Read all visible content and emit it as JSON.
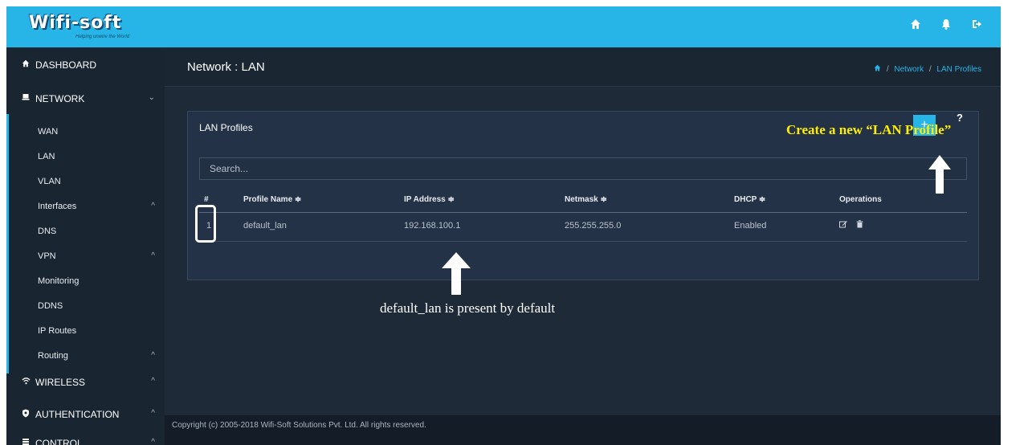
{
  "brand": {
    "logo_text": "Wifi-soft",
    "tagline": "Helping unwire the World"
  },
  "topbar": {
    "icons": [
      "home-icon",
      "bell-icon",
      "sign-out-icon"
    ]
  },
  "sidebar": {
    "sections": [
      {
        "label": "DASHBOARD",
        "icon": "home-icon"
      },
      {
        "label": "NETWORK",
        "icon": "monitor-icon",
        "caret": "⌄"
      },
      {
        "label": "WIRELESS",
        "icon": "wifi-icon",
        "caret": "^"
      },
      {
        "label": "AUTHENTICATION",
        "icon": "shield-icon",
        "caret": "^"
      },
      {
        "label": "CONTROL",
        "icon": "control-icon",
        "caret": "^"
      }
    ],
    "network_items": [
      {
        "label": "WAN"
      },
      {
        "label": "LAN"
      },
      {
        "label": "VLAN"
      },
      {
        "label": "Interfaces",
        "caret": "^"
      },
      {
        "label": "DNS"
      },
      {
        "label": "VPN",
        "caret": "^"
      },
      {
        "label": "Monitoring"
      },
      {
        "label": "DDNS"
      },
      {
        "label": "IP Routes"
      },
      {
        "label": "Routing",
        "caret": "^"
      }
    ]
  },
  "page": {
    "title": "Network : LAN",
    "breadcrumb": {
      "home_icon": "home-icon",
      "sep": "/",
      "items": [
        "Network",
        "LAN Profiles"
      ]
    }
  },
  "card": {
    "title": "LAN Profiles",
    "help": "?",
    "add_button": "+",
    "search_placeholder": "Search...",
    "columns": [
      "#",
      "Profile Name ≑",
      "IP Address ≑",
      "Netmask ≑",
      "DHCP ≑",
      "Operations"
    ],
    "rows": [
      {
        "index": "1",
        "name": "default_lan",
        "ip": "192.168.100.1",
        "netmask": "255.255.255.0",
        "dhcp": "Enabled",
        "ops": [
          "edit-icon",
          "trash-icon"
        ]
      }
    ]
  },
  "footer": {
    "text": "Copyright (c) 2005-2018 Wifi-Soft Solutions Pvt. Ltd. All rights reserved."
  },
  "annotations": {
    "create_new": "Create a new “LAN Profile”",
    "default_note": "default_lan is present by default"
  },
  "colors": {
    "accent": "#27b4e7",
    "annotation_yellow": "#ffee00"
  }
}
